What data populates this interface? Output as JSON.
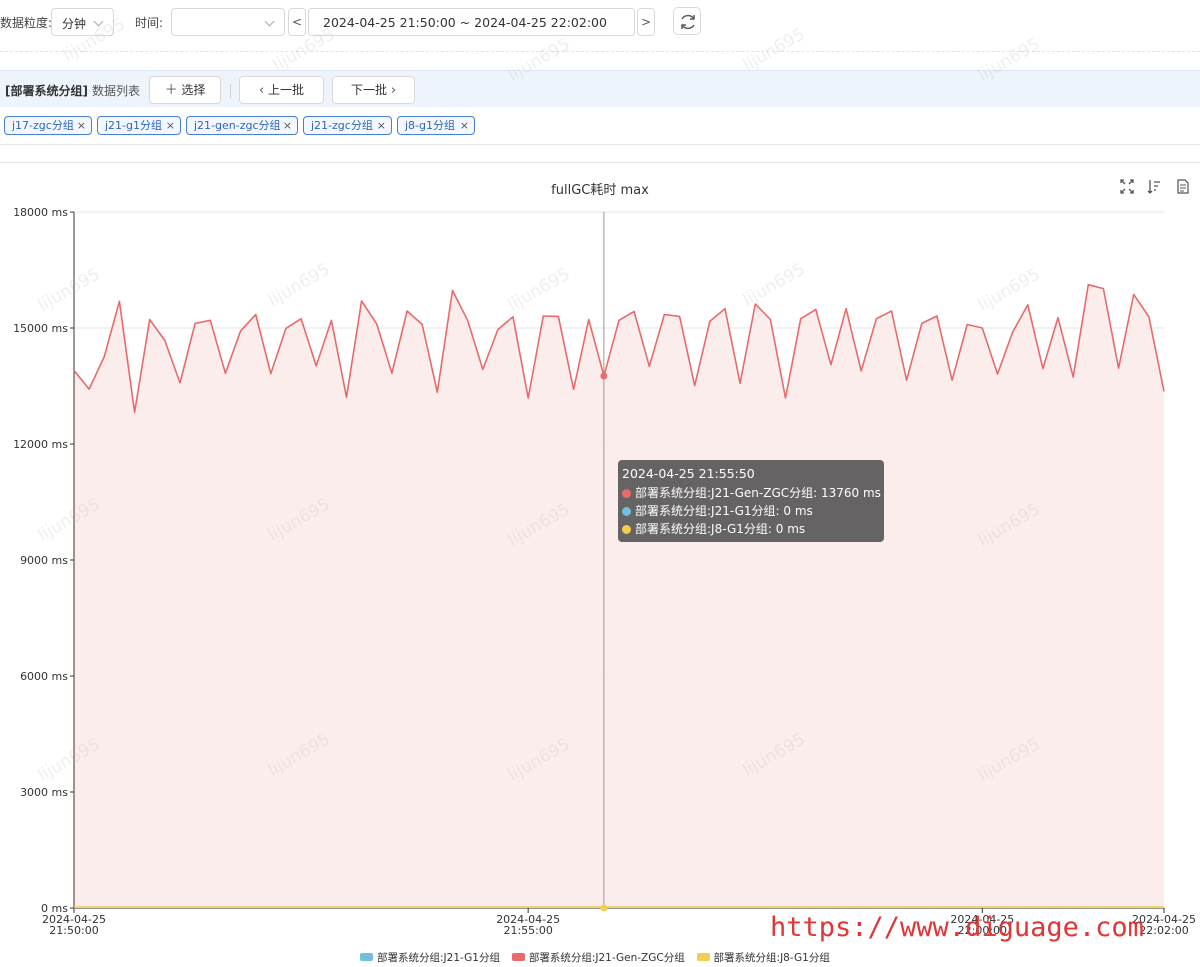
{
  "toolbar": {
    "granularity_label": "数据粒度:",
    "granularity_value": "分钟",
    "time_label": "时间:",
    "time_value": "",
    "prev_label": "<",
    "next_label": ">",
    "range_text": "2024-04-25 21:50:00  ~  2024-04-25 22:02:00"
  },
  "group_bar": {
    "title": "[部署系统分组]",
    "subtitle": "数据列表",
    "select_label": "选择",
    "prev_batch_label": "上一批",
    "next_batch_label": "下一批"
  },
  "tags": [
    "j17-zgc分组",
    "j21-g1分组",
    "j21-gen-zgc分组",
    "j21-zgc分组",
    "j8-g1分组"
  ],
  "tag_close": "×",
  "watermark": "lijun695",
  "chart_data": {
    "type": "area",
    "title": "fullGC耗时 max",
    "ylim": [
      0,
      18000
    ],
    "y_ticks": [
      "0 ms",
      "3000 ms",
      "6000 ms",
      "9000 ms",
      "12000 ms",
      "15000 ms",
      "18000 ms"
    ],
    "x_ticks": [
      {
        "date": "2024-04-25",
        "time": "21:50:00"
      },
      {
        "date": "2024-04-25",
        "time": "21:55:00"
      },
      {
        "date": "2024-04-25",
        "time": "22:00:00"
      },
      {
        "date": "2024-04-25",
        "time": "22:02:00"
      }
    ],
    "x_start": "2024-04-25 21:50:00",
    "x_end": "2024-04-25 22:02:00",
    "step_seconds": 10,
    "grid": true,
    "legend_position": "bottom",
    "series": [
      {
        "name": "部署系统分组:J21-G1分组",
        "color": "#73c0de",
        "values": [
          0
        ]
      },
      {
        "name": "部署系统分组:J21-Gen-ZGC分组",
        "color": "#e86a6a",
        "values": [
          13900,
          13420,
          14260,
          15690,
          12820,
          15220,
          14680,
          13580,
          15120,
          15200,
          13830,
          14920,
          15350,
          13820,
          14990,
          15240,
          14020,
          15200,
          13210,
          15700,
          15100,
          13830,
          15440,
          15090,
          13340,
          15970,
          15200,
          13930,
          14960,
          15290,
          13190,
          15310,
          15300,
          13410,
          15220,
          13760,
          15200,
          15430,
          14010,
          15350,
          15300,
          13510,
          15170,
          15500,
          13570,
          15620,
          15220,
          13190,
          15240,
          15480,
          14050,
          15500,
          13890,
          15240,
          15440,
          13650,
          15120,
          15310,
          13650,
          15090,
          15000,
          13810,
          14890,
          15600,
          13950,
          15270,
          13730,
          16120,
          16020,
          13960,
          15870,
          15290,
          13360
        ]
      },
      {
        "name": "部署系统分组:J8-G1分组",
        "color": "#f6cd4d",
        "values": [
          0
        ]
      }
    ],
    "tooltip": {
      "time": "2024-04-25 21:55:50",
      "rows": [
        {
          "text": "部署系统分组:J21-Gen-ZGC分组: 13760 ms",
          "color": "#e86a6a"
        },
        {
          "text": "部署系统分组:J21-G1分组: 0 ms",
          "color": "#73c0de"
        },
        {
          "text": "部署系统分组:J8-G1分组: 0 ms",
          "color": "#f6cd4d"
        }
      ]
    },
    "legend": [
      {
        "name": "部署系统分组:J21-G1分组",
        "color": "#73c0de"
      },
      {
        "name": "部署系统分组:J21-Gen-ZGC分组",
        "color": "#e86a6a"
      },
      {
        "name": "部署系统分组:J8-G1分组",
        "color": "#f6cd4d"
      }
    ]
  },
  "footer": {
    "site": "https://www.diguage.com"
  }
}
